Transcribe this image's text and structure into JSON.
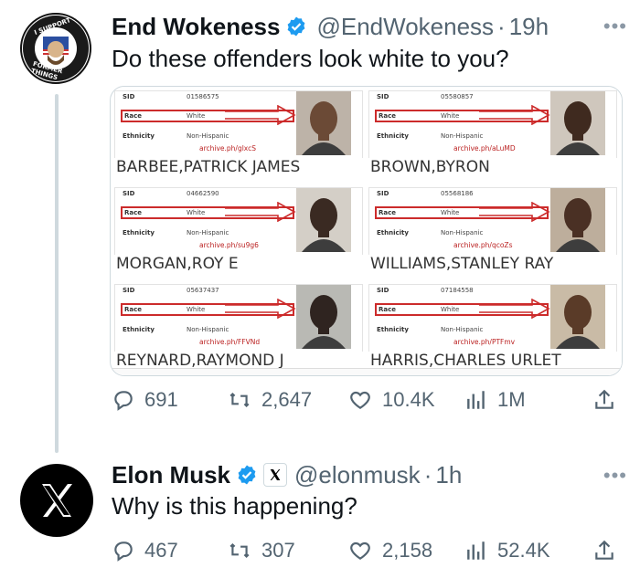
{
  "tweet1": {
    "name": "End Wokeness",
    "handle": "@EndWokeness",
    "time": "19h",
    "text": "Do these offenders look white to you?",
    "avatar_top_text": "I SUPPORT THE",
    "avatar_bottom_text": "FORMER THINGS",
    "stats": {
      "replies": "691",
      "reposts": "2,647",
      "likes": "10.4K",
      "views": "1M"
    }
  },
  "mugshots": [
    {
      "sid": "01586575",
      "race": "White",
      "ethnicity": "Non-Hispanic",
      "archive": "archive.ph/glxcS",
      "name": "BARBEE,PATRICK JAMES",
      "skin": "#6b4a36",
      "bg": "#bdb3a8"
    },
    {
      "sid": "05580857",
      "race": "White",
      "ethnicity": "Non-Hispanic",
      "archive": "archive.ph/aLuMD",
      "name": "BROWN,BYRON",
      "skin": "#3f2a1f",
      "bg": "#cfc7bd"
    },
    {
      "sid": "04662590",
      "race": "White",
      "ethnicity": "Non-Hispanic",
      "archive": "archive.ph/su9g6",
      "name": "MORGAN,ROY E",
      "skin": "#3a2a22",
      "bg": "#d4cfc7"
    },
    {
      "sid": "05568186",
      "race": "White",
      "ethnicity": "Non-Hispanic",
      "archive": "archive.ph/qcoZs",
      "name": "WILLIAMS,STANLEY RAY",
      "skin": "#4a3024",
      "bg": "#bdae9c"
    },
    {
      "sid": "05637437",
      "race": "White",
      "ethnicity": "Non-Hispanic",
      "archive": "archive.ph/FFVNd",
      "name": "REYNARD,RAYMOND J",
      "skin": "#2f2420",
      "bg": "#b9b9b4"
    },
    {
      "sid": "07184558",
      "race": "White",
      "ethnicity": "Non-Hispanic",
      "archive": "archive.ph/PTFmv",
      "name": "HARRIS,CHARLES URLET",
      "skin": "#5a3b28",
      "bg": "#c9bba6"
    }
  ],
  "labels": {
    "sid": "SID",
    "race": "Race",
    "ethnicity": "Ethnicity"
  },
  "tweet2": {
    "name": "Elon Musk",
    "handle": "@elonmusk",
    "time": "1h",
    "text": "Why is this happening?",
    "stats": {
      "replies": "467",
      "reposts": "307",
      "likes": "2,158",
      "views": "52.4K"
    }
  },
  "colors": {
    "verified": "#1d9bf0",
    "muted": "#536471",
    "accent_red": "#cc2b2b"
  },
  "icons": [
    "reply-icon",
    "repost-icon",
    "like-icon",
    "views-icon",
    "share-icon",
    "more-icon",
    "verified-badge-icon",
    "x-logo-icon"
  ]
}
